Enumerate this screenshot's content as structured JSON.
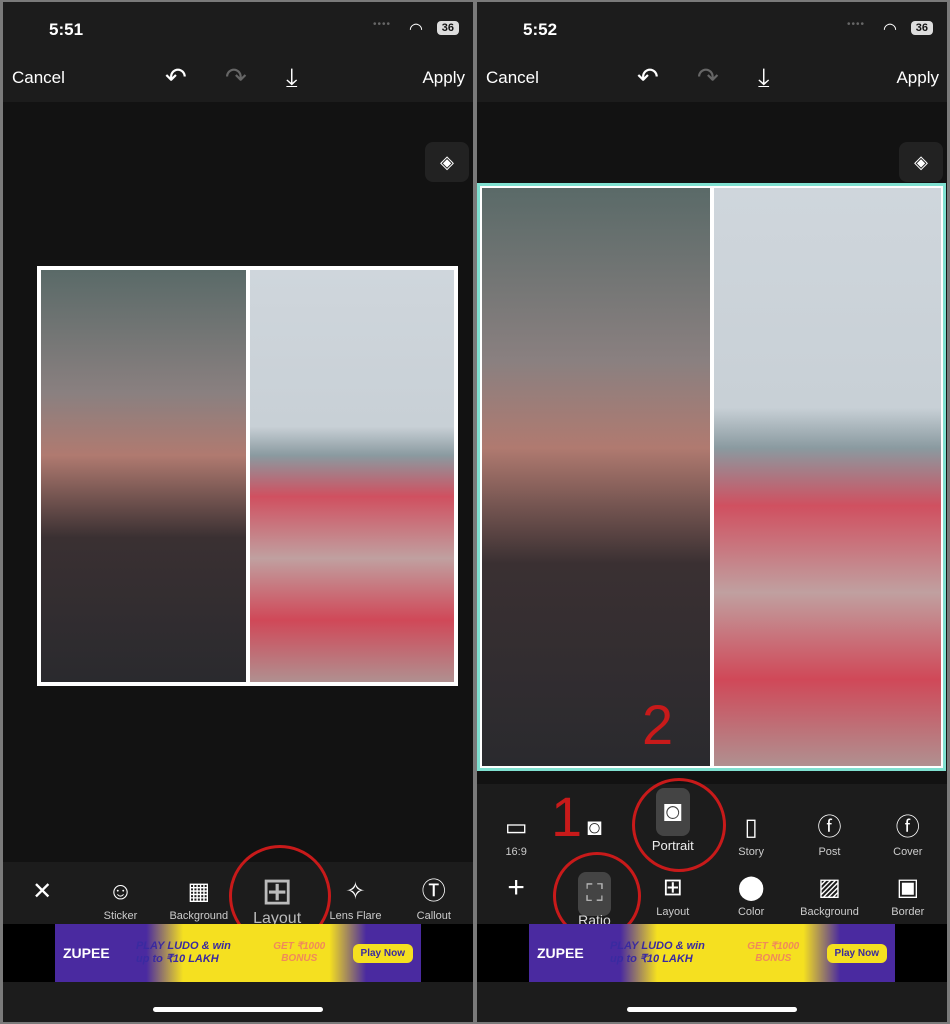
{
  "left": {
    "time": "5:51",
    "battery": "36",
    "nav": {
      "cancel": "Cancel",
      "apply": "Apply"
    },
    "toolbar": [
      {
        "icon": "close-icon",
        "label": ""
      },
      {
        "icon": "sticker-icon",
        "label": "Sticker"
      },
      {
        "icon": "checker-icon",
        "label": "Background"
      },
      {
        "icon": "layout-icon",
        "label": "Layout"
      },
      {
        "icon": "sparkle-icon",
        "label": "Lens Flare"
      },
      {
        "icon": "callout-icon",
        "label": "Callout"
      }
    ]
  },
  "right": {
    "time": "5:52",
    "battery": "36",
    "nav": {
      "cancel": "Cancel",
      "apply": "Apply"
    },
    "ratios": [
      {
        "icon": "landscape-icon",
        "label": "16:9"
      },
      {
        "icon": "instagram-icon",
        "label": ""
      },
      {
        "icon": "instagram-icon",
        "label": "Portrait"
      },
      {
        "icon": "instagram-story-icon",
        "label": "Story"
      },
      {
        "icon": "facebook-icon",
        "label": "Post"
      },
      {
        "icon": "facebook-icon",
        "label": "Cover"
      }
    ],
    "toolbar": [
      {
        "icon": "plus-icon",
        "label": ""
      },
      {
        "icon": "ratio-icon",
        "label": "Ratio"
      },
      {
        "icon": "layout-icon",
        "label": "Layout"
      },
      {
        "icon": "color-icon",
        "label": "Color"
      },
      {
        "icon": "stripes-icon",
        "label": "Background"
      },
      {
        "icon": "border-icon",
        "label": "Border"
      }
    ],
    "annotations": [
      "1",
      "2"
    ]
  },
  "ad": {
    "brand": "ZUPEE",
    "headline": "PLAY LUDO & win up to ₹10 LAKH",
    "bonus": "GET ₹1000 BONUS",
    "cta": "Play Now"
  },
  "colors": {
    "highlight": "#c81a1a",
    "selection_border": "#7fe0d0"
  }
}
